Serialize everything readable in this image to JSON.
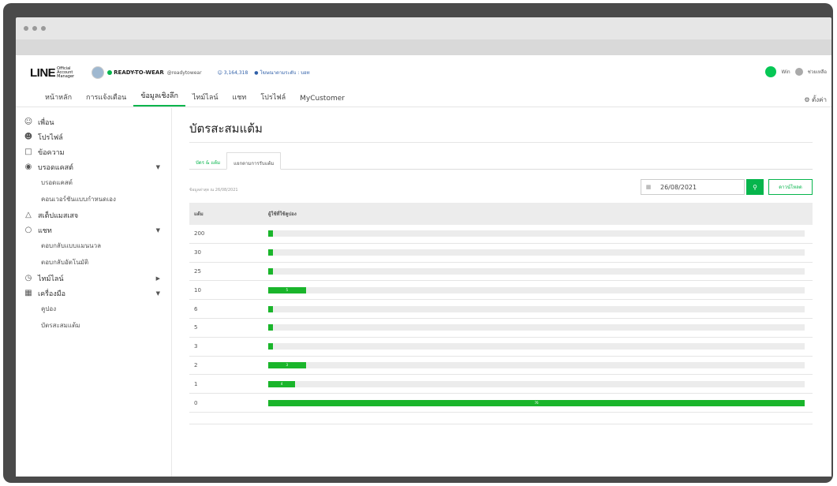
{
  "topbar": {
    "logo": "LINE",
    "logo_sub": "Official Account Manager",
    "account_name": "READY-TO-WEAR",
    "account_id": "@readytowear",
    "followers": "3,164,318",
    "plan": "โฆษณาตามระดับ : บอท",
    "status_label": "Win",
    "help_label": "ช่วยเหลือ"
  },
  "nav": {
    "items": [
      "หน้าหลัก",
      "การแจ้งเตือน",
      "ข้อมูลเชิงลึก",
      "ไทม์ไลน์",
      "แชท",
      "โปรไฟล์",
      "MyCustomer"
    ],
    "settings": "ตั้งค่า"
  },
  "sidebar": {
    "items": [
      {
        "label": "เพื่อน"
      },
      {
        "label": "โปรไฟล์"
      },
      {
        "label": "ข้อความ"
      },
      {
        "label": "บรอดแคสต์"
      },
      {
        "label": "บรอดแคสต์"
      },
      {
        "label": "คอนเวอร์ชันแบบกำหนดเอง"
      },
      {
        "label": "สเต็ปแมสเสจ"
      },
      {
        "label": "แชท"
      },
      {
        "label": "ตอบกลับแบบแมนนวล"
      },
      {
        "label": "ตอบกลับอัตโนมัติ"
      },
      {
        "label": "ไทม์ไลน์"
      },
      {
        "label": "เครื่องมือ"
      },
      {
        "label": "คูปอง"
      },
      {
        "label": "บัตรสะสมแต้ม"
      }
    ]
  },
  "main": {
    "title": "บัตรสะสมแต้ม",
    "tabs": [
      "บัตร & แต้ม",
      "แยกตามการรับแต้ม"
    ],
    "as_of": "ข้อมูลล่าสุด ณ 26/08/2021",
    "date_value": "26/08/2021",
    "download_label": "ดาวน์โหลด",
    "table": {
      "col1": "แต้ม",
      "col2": "ผู้ใช้ที่ใช้คูปอง",
      "rows": [
        {
          "points": "200",
          "fraction": 0.007,
          "label": ""
        },
        {
          "points": "30",
          "fraction": 0.007,
          "label": ""
        },
        {
          "points": "25",
          "fraction": 0.007,
          "label": ""
        },
        {
          "points": "10",
          "fraction": 0.07,
          "label": "5"
        },
        {
          "points": "6",
          "fraction": 0.007,
          "label": ""
        },
        {
          "points": "5",
          "fraction": 0.007,
          "label": ""
        },
        {
          "points": "3",
          "fraction": 0.007,
          "label": ""
        },
        {
          "points": "2",
          "fraction": 0.07,
          "label": "3"
        },
        {
          "points": "1",
          "fraction": 0.05,
          "label": "4"
        },
        {
          "points": "0",
          "fraction": 1.0,
          "label": "76"
        }
      ]
    }
  },
  "colors": {
    "accent": "#06b54c",
    "bar": "#1ab52b"
  }
}
